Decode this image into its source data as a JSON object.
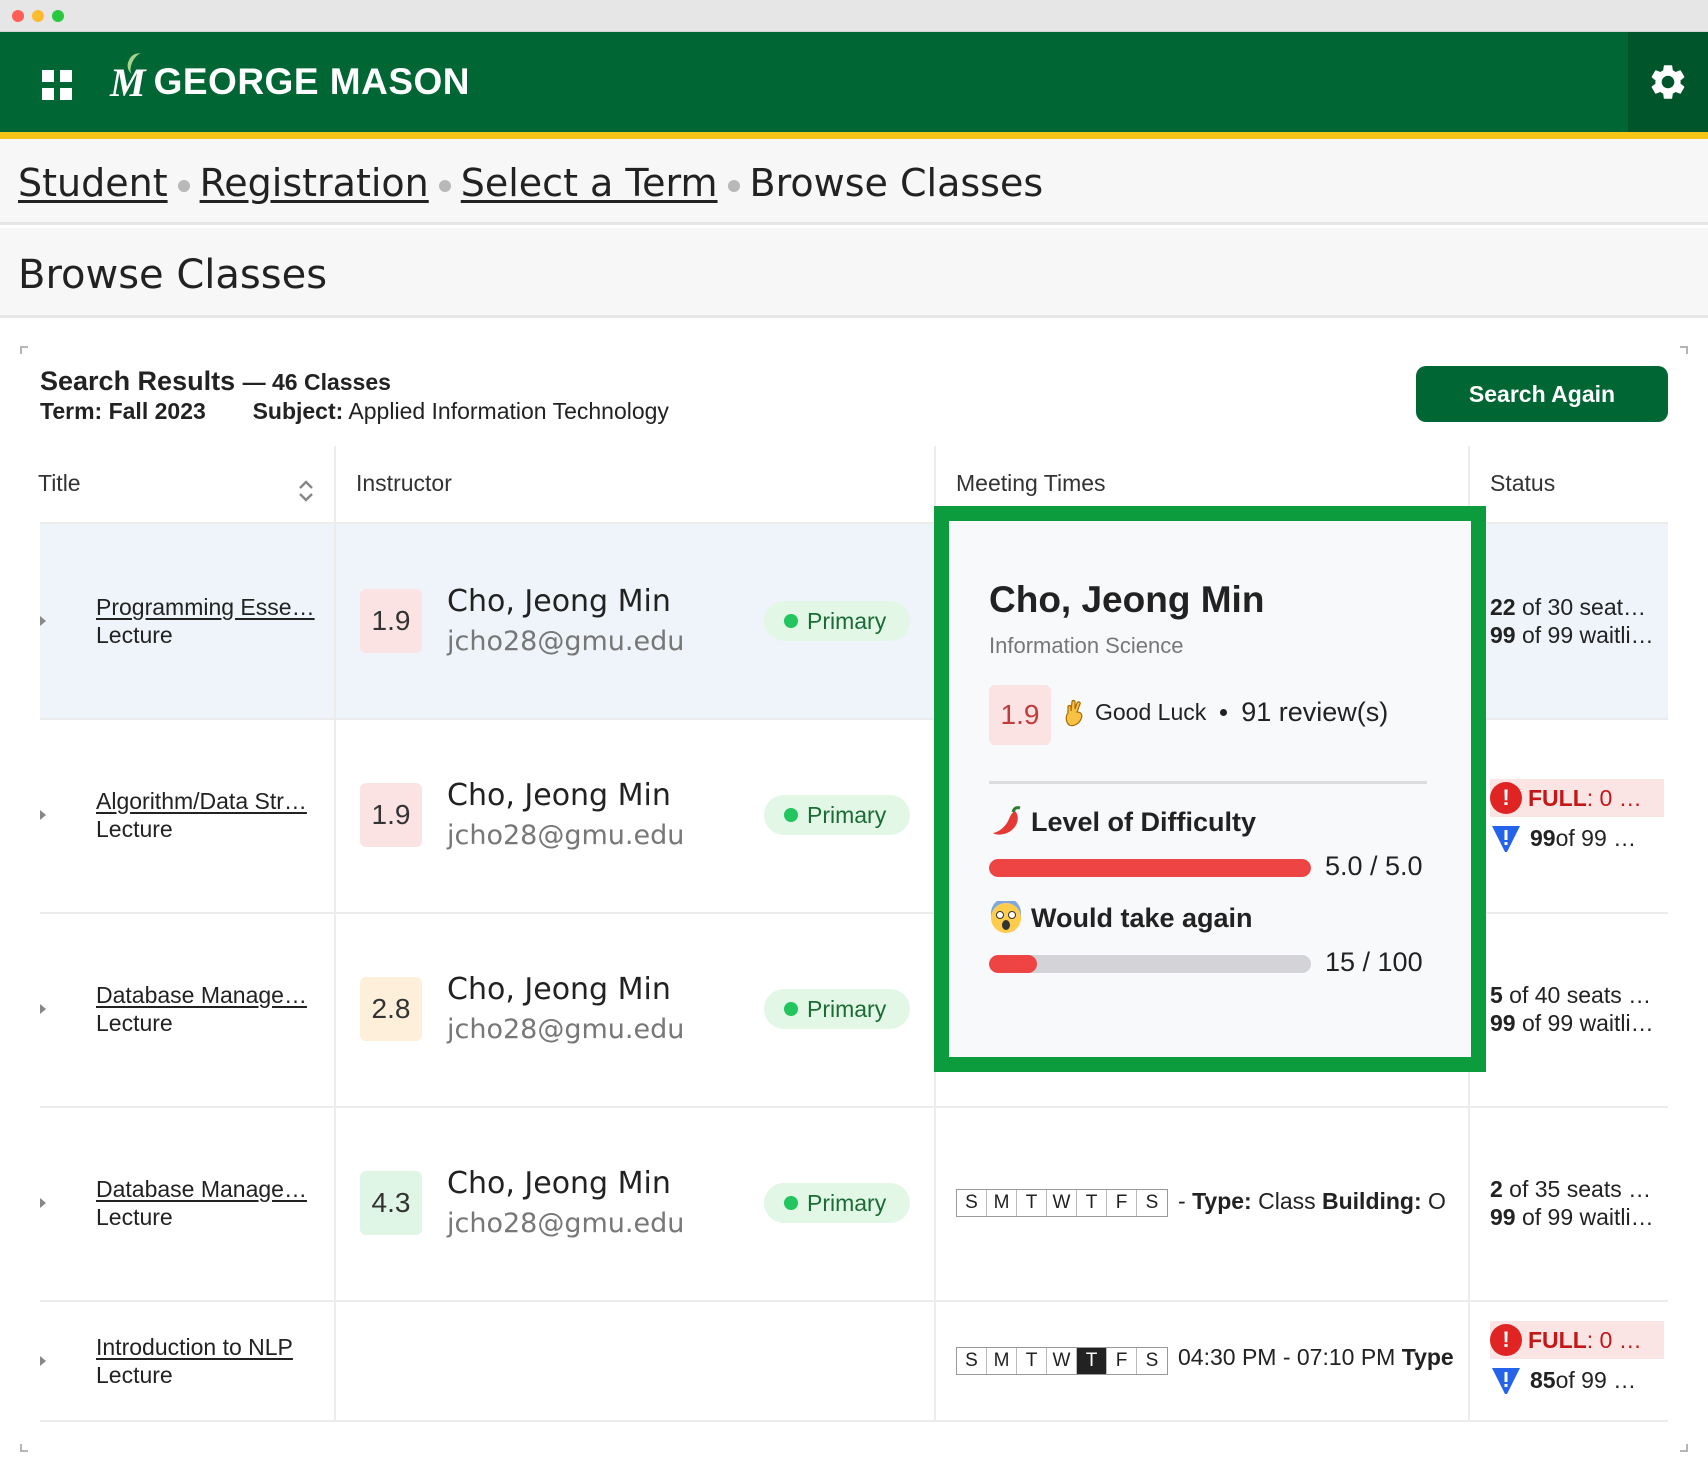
{
  "header": {
    "logo_text": "GEORGE MASON",
    "logo_mark": "M",
    "icons": {
      "apps": "apps-grid-icon",
      "settings": "gear-icon"
    },
    "colors": {
      "brand_green": "#006633",
      "gold": "#F5C518"
    }
  },
  "breadcrumb": [
    {
      "label": "Student"
    },
    {
      "label": "Registration"
    },
    {
      "label": "Select a Term"
    },
    {
      "label": "Browse Classes"
    }
  ],
  "page_title": "Browse Classes",
  "results": {
    "title": "Search Results",
    "count_text": "— 46 Classes",
    "term_label": "Term:",
    "term_value": "Fall 2023",
    "subject_label": "Subject:",
    "subject_value": "Applied Information Technology",
    "search_again": "Search Again"
  },
  "table": {
    "headers": {
      "title": "Title",
      "instructor": "Instructor",
      "meeting": "Meeting Times",
      "status": "Status"
    },
    "rows": [
      {
        "course": "Programming Esse…",
        "type": "Lecture",
        "rating": "1.9",
        "instructor": "Cho, Jeong Min",
        "email": "jcho28@gmu.edu",
        "role": "Primary",
        "status_seats_num": "22",
        "status_seats_text": " of 30 seat…",
        "status_wait_num": "99",
        "status_wait_text": " of 99 waitli…"
      },
      {
        "course": "Algorithm/Data Str…",
        "type": "Lecture",
        "rating": "1.9",
        "instructor": "Cho, Jeong Min",
        "email": "jcho28@gmu.edu",
        "role": "Primary",
        "full_label": "FULL",
        "full_text": ": 0 …",
        "status_wait_num": "99",
        "status_wait_text": " of 99 …"
      },
      {
        "course": "Database Manage…",
        "type": "Lecture",
        "rating": "2.8",
        "instructor": "Cho, Jeong Min",
        "email": "jcho28@gmu.edu",
        "role": "Primary",
        "status_seats_num": "5",
        "status_seats_text": " of 40 seats …",
        "status_wait_num": "99",
        "status_wait_text": " of 99 waitli…"
      },
      {
        "course": "Database Manage…",
        "type": "Lecture",
        "rating": "4.3",
        "instructor": "Cho, Jeong Min",
        "email": "jcho28@gmu.edu",
        "role": "Primary",
        "days": [
          "S",
          "M",
          "T",
          "W",
          "T",
          "F",
          "S"
        ],
        "meeting_prefix": "- ",
        "type_label": "Type:",
        "type_value": " Class ",
        "building_label": "Building:",
        "building_value": " O",
        "status_seats_num": "2",
        "status_seats_text": " of 35 seats …",
        "status_wait_num": "99",
        "status_wait_text": " of 99 waitli…"
      },
      {
        "course": "Introduction to NLP",
        "type": "Lecture",
        "days": [
          "S",
          "M",
          "T",
          "W",
          "T",
          "F",
          "S"
        ],
        "active_day_index": 4,
        "meeting_time": "04:30 PM - 07:10 PM ",
        "type_label": "Type",
        "full_label": "FULL",
        "full_text": ": 0 …",
        "status_wait_num": "85",
        "status_wait_text": " of 99 …"
      }
    ]
  },
  "popup": {
    "name": "Cho, Jeong Min",
    "department": "Information Science",
    "rating": "1.9",
    "luck_icon": "crossed-fingers-icon",
    "luck_text": "Good Luck",
    "reviews": "91 review(s)",
    "difficulty": {
      "icon": "chili-pepper-icon",
      "label": "Level of Difficulty",
      "value": 5.0,
      "max": 5.0,
      "display": "5.0 / 5.0"
    },
    "take_again": {
      "icon": "screaming-face-icon",
      "label": "Would take again",
      "value": 15,
      "max": 100,
      "display": "15 / 100"
    },
    "colors": {
      "highlight_border": "#0C9B3D",
      "bar_fill": "#EF4444"
    }
  }
}
